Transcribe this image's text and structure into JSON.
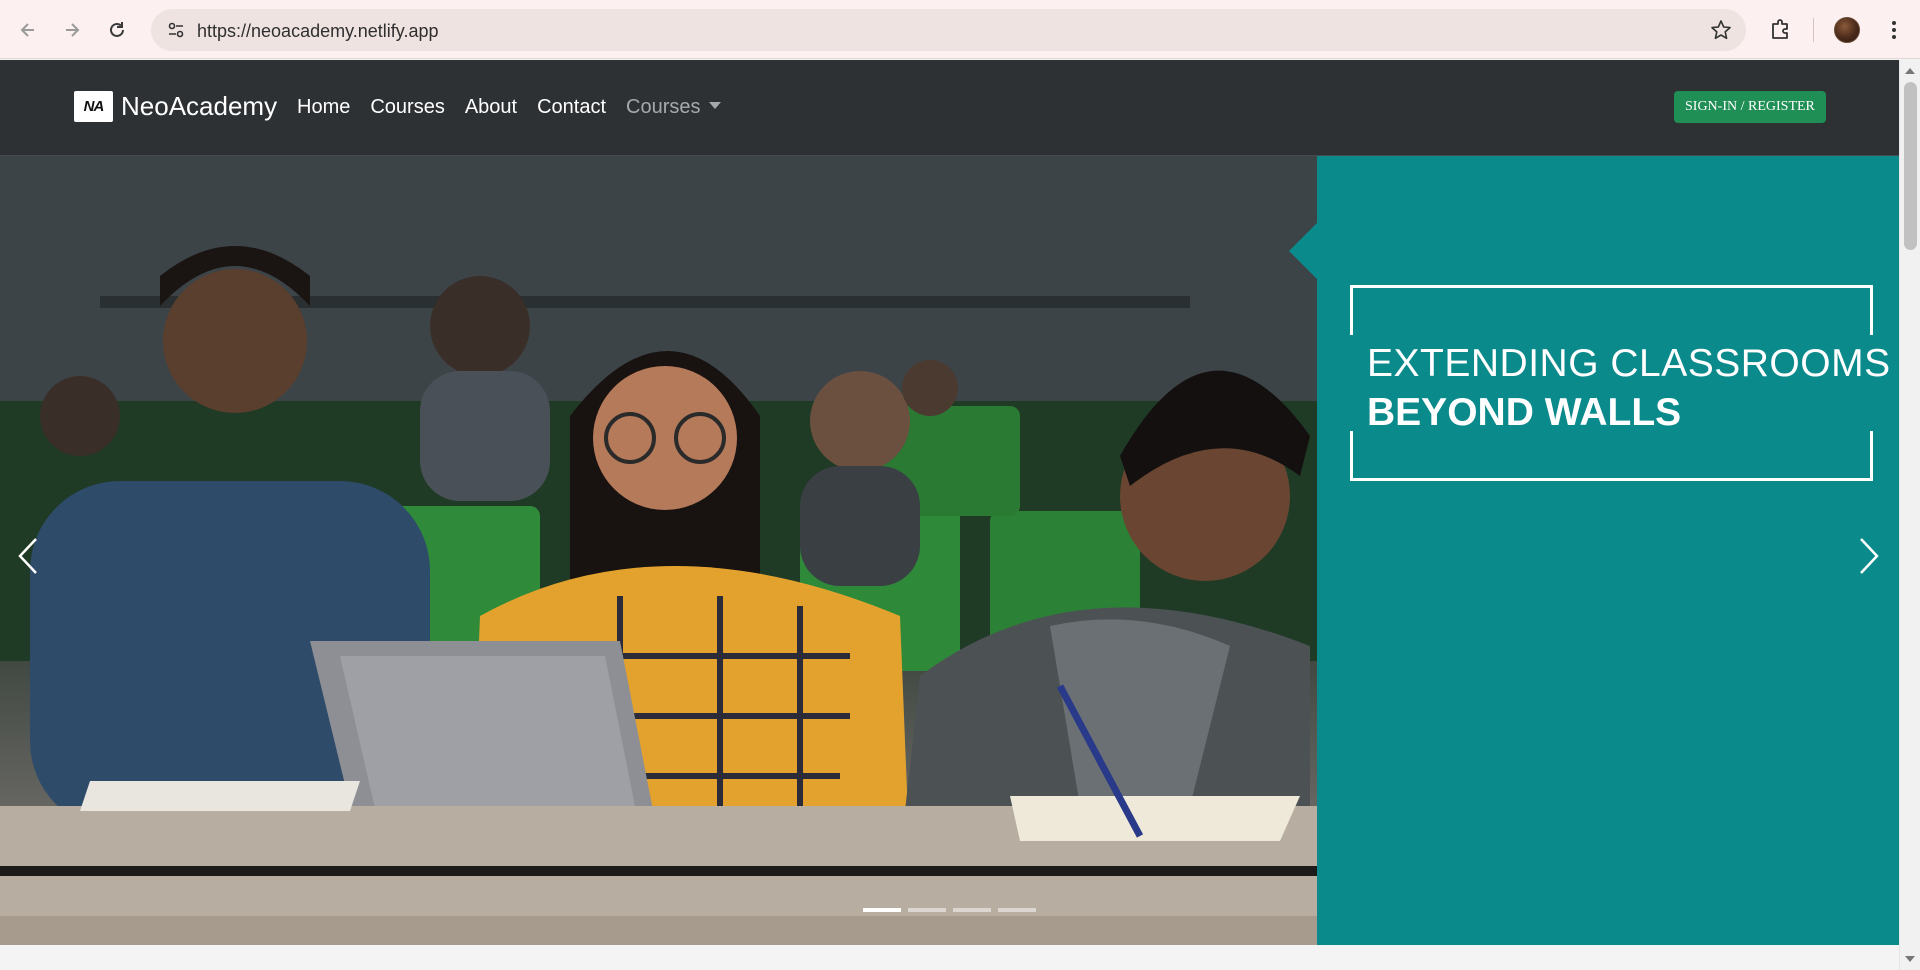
{
  "browser": {
    "url": "https://neoacademy.netlify.app",
    "icons": [
      "back-arrow-icon",
      "forward-arrow-icon",
      "reload-icon",
      "site-info-icon",
      "bookmark-star-icon",
      "extensions-icon",
      "profile-avatar",
      "kebab-menu-icon"
    ]
  },
  "navbar": {
    "brand_logo": "NA",
    "brand_name": "NeoAcademy",
    "links": [
      "Home",
      "Courses",
      "About",
      "Contact"
    ],
    "dropdown_label": "Courses",
    "signin_label": "SIGN-IN / REGISTER",
    "colors": {
      "background": "#2d3134",
      "signin": "#1f8f55"
    }
  },
  "hero": {
    "tagline_line1": "EXTENDING CLASSROOMS",
    "tagline_line2": "BEYOND WALLS",
    "slide_count": 4,
    "active_slide": 1,
    "panel_color": "#0b8a8c"
  }
}
